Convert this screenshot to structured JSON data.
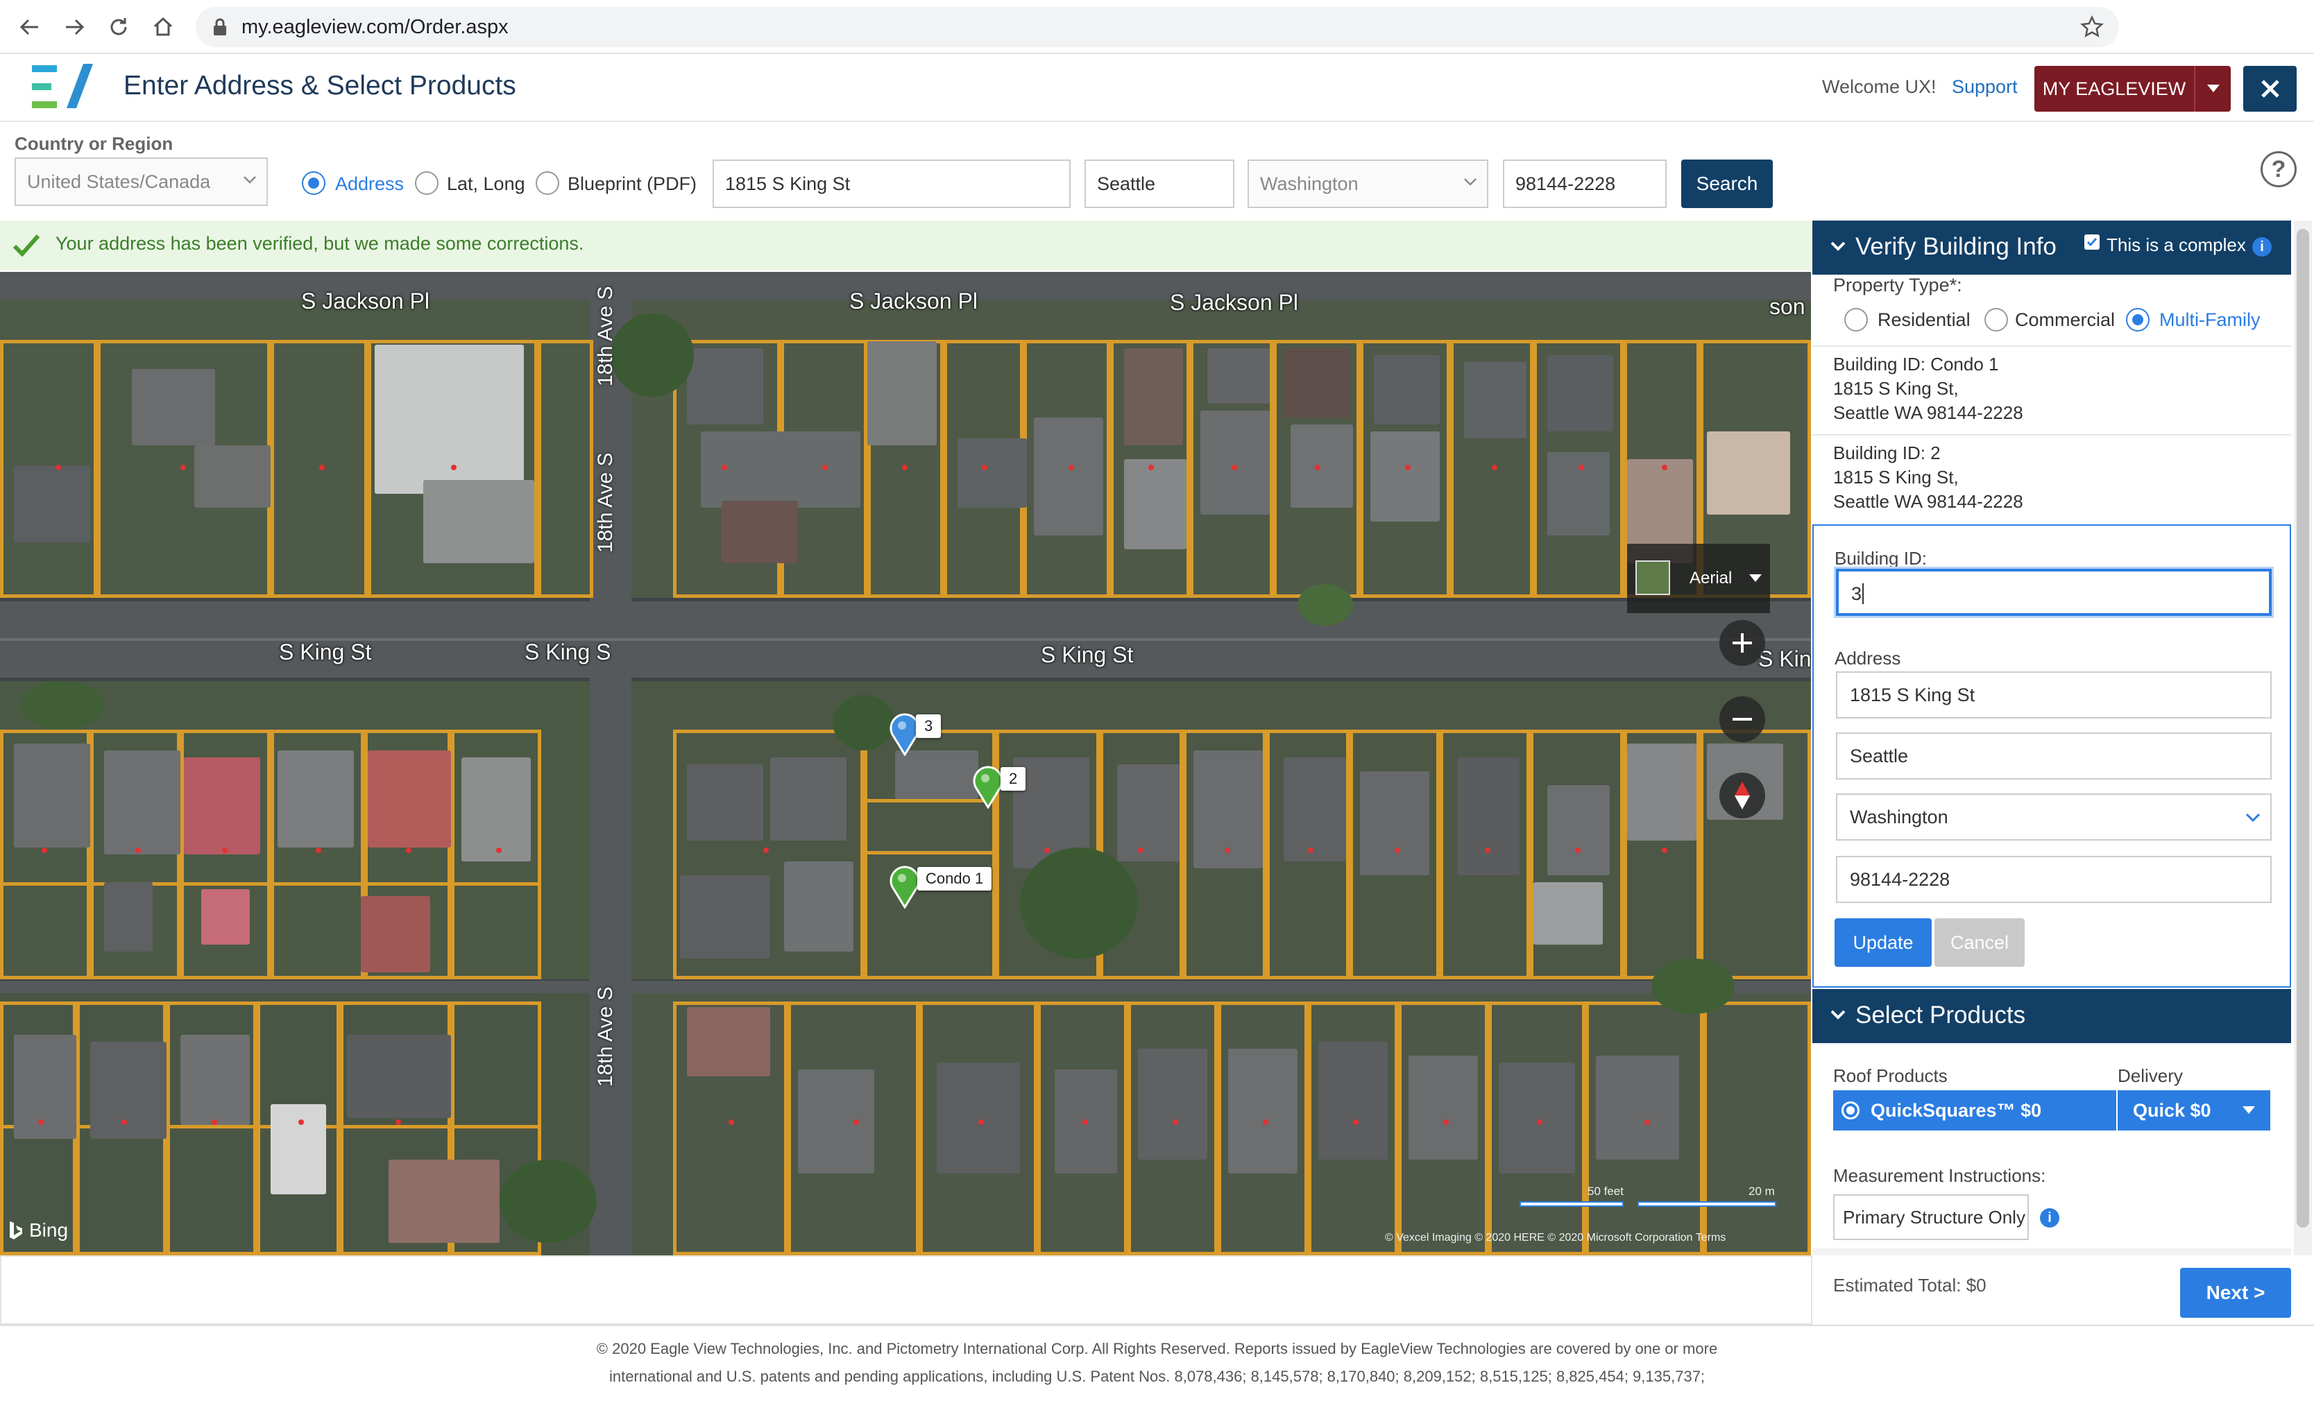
{
  "browser": {
    "url": "my.eagleview.com/Order.aspx"
  },
  "header": {
    "title": "Enter Address & Select Products",
    "welcome": "Welcome UX!",
    "support": "Support",
    "my_eagleview": "MY EAGLEVIEW"
  },
  "search": {
    "country_label": "Country or Region",
    "country_value": "United States/Canada",
    "modes": [
      "Address",
      "Lat, Long",
      "Blueprint (PDF)"
    ],
    "selected_mode": "Address",
    "street": "1815 S King St",
    "city": "Seattle",
    "state": "Washington",
    "zip": "98144-2228",
    "search_button": "Search",
    "help": "?"
  },
  "notice": "Your address has been verified, but we made some corrections.",
  "map": {
    "streets": {
      "jackson_1": "S Jackson Pl",
      "jackson_2": "S Jackson Pl",
      "jackson_3": "S Jackson Pl",
      "jackson_4": "son P",
      "king_1": "S King St",
      "king_2": "S King S",
      "king_3": "S King St",
      "king_4": "S Kin",
      "ave_1": "18th Ave S",
      "ave_2": "18th Ave S",
      "ave_3": "18th Ave S"
    },
    "layer": "Aerial",
    "pins": [
      {
        "label": "3",
        "color": "#3d8de0"
      },
      {
        "label": "2",
        "color": "#4caf3c"
      },
      {
        "label": "Condo 1",
        "color": "#4caf3c"
      }
    ],
    "scale_feet": "50 feet",
    "scale_m": "20 m",
    "attribution": "© Vexcel Imaging © 2020 HERE © 2020 Microsoft Corporation Terms",
    "provider": "Bing"
  },
  "verify": {
    "title": "Verify Building Info",
    "complex_label": "This is a complex",
    "complex_checked": true,
    "property_type_label": "Property Type*:",
    "property_types": [
      "Residential",
      "Commercial",
      "Multi-Family"
    ],
    "selected_type": "Multi-Family",
    "buildings": [
      {
        "id": "Building ID: Condo 1",
        "line1": "1815 S King St,",
        "line2": "Seattle WA 98144-2228"
      },
      {
        "id": "Building ID: 2",
        "line1": "1815 S King St,",
        "line2": "Seattle WA 98144-2228"
      }
    ],
    "building_id_label": "Building ID:",
    "building_id_value": "3",
    "address_label": "Address",
    "street": "1815 S King St",
    "city": "Seattle",
    "state": "Washington",
    "zip": "98144-2228",
    "update": "Update",
    "cancel": "Cancel"
  },
  "products": {
    "title": "Select Products",
    "roof_label": "Roof Products",
    "delivery_label": "Delivery",
    "roof_value": "QuickSquares™ $0",
    "delivery_value": "Quick $0",
    "instructions_label": "Measurement Instructions:",
    "instructions_value": "Primary Structure Only",
    "estimated_total": "Estimated Total: $0",
    "next": "Next >"
  },
  "footer": {
    "line1": "© 2020 Eagle View Technologies, Inc. and Pictometry International Corp. All Rights Reserved. Reports issued by EagleView Technologies are covered by one or more",
    "line2": "international and U.S. patents and pending applications, including U.S. Patent Nos. 8,078,436; 8,145,578; 8,170,840; 8,209,152; 8,515,125; 8,825,454; 9,135,737;"
  },
  "colors": {
    "brand_navy": "#123f66",
    "brand_maroon": "#7b1b24",
    "accent_blue": "#2b7de1",
    "lot_line": "#d89b2a"
  }
}
